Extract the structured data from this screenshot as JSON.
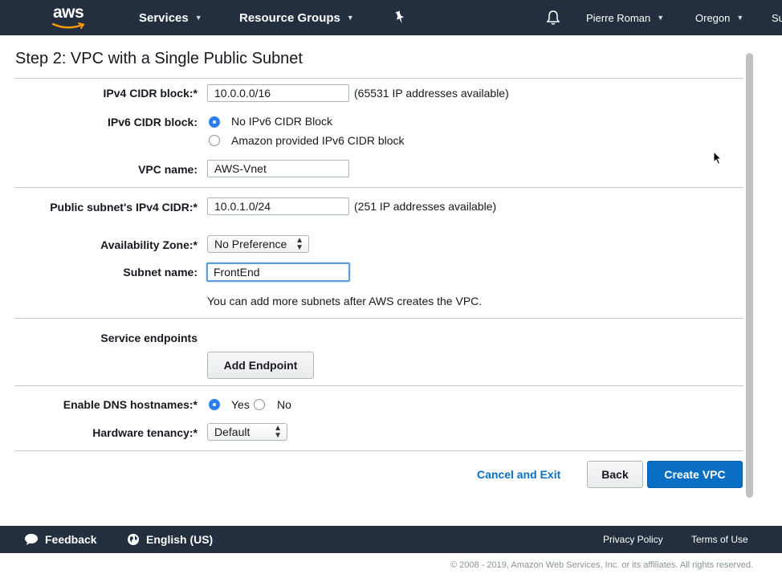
{
  "nav": {
    "logo_text": "aws",
    "services": "Services",
    "resource_groups": "Resource Groups",
    "user": "Pierre Roman",
    "region": "Oregon",
    "support_truncated": "Su"
  },
  "page": {
    "title": "Step 2: VPC with a Single Public Subnet"
  },
  "form": {
    "ipv4_cidr": {
      "label": "IPv4 CIDR block:*",
      "value": "10.0.0.0/16",
      "hint": "(65531 IP addresses available)"
    },
    "ipv6_cidr": {
      "label": "IPv6 CIDR block:",
      "options": [
        "No IPv6 CIDR Block",
        "Amazon provided IPv6 CIDR block"
      ],
      "selected": "No IPv6 CIDR Block"
    },
    "vpc_name": {
      "label": "VPC name:",
      "value": "AWS-Vnet"
    },
    "public_subnet_cidr": {
      "label": "Public subnet's IPv4 CIDR:*",
      "value": "10.0.1.0/24",
      "hint": "(251 IP addresses available)"
    },
    "availability_zone": {
      "label": "Availability Zone:*",
      "value": "No Preference"
    },
    "subnet_name": {
      "label": "Subnet name:",
      "value": "FrontEnd"
    },
    "subnet_note": "You can add more subnets after AWS creates the VPC.",
    "service_endpoints": {
      "label": "Service endpoints",
      "button": "Add Endpoint"
    },
    "dns_hostnames": {
      "label": "Enable DNS hostnames:*",
      "options": [
        "Yes",
        "No"
      ],
      "selected": "Yes"
    },
    "hardware_tenancy": {
      "label": "Hardware tenancy:*",
      "value": "Default"
    }
  },
  "actions": {
    "cancel": "Cancel and Exit",
    "back": "Back",
    "create": "Create VPC"
  },
  "footer": {
    "feedback": "Feedback",
    "language": "English (US)",
    "privacy": "Privacy Policy",
    "terms": "Terms of Use",
    "copyright": "© 2008 - 2019, Amazon Web Services, Inc. or its affiliates. All rights reserved."
  },
  "colors": {
    "nav_bg": "#232f3e",
    "accent_blue": "#0a6fc2",
    "radio_on": "#2e7df3",
    "logo_smile": "#ff9900"
  },
  "icons": [
    "aws-logo",
    "chevron-down-icon",
    "pin-icon",
    "bell-icon",
    "speech-bubble-icon",
    "globe-icon",
    "mouse-pointer-icon"
  ]
}
